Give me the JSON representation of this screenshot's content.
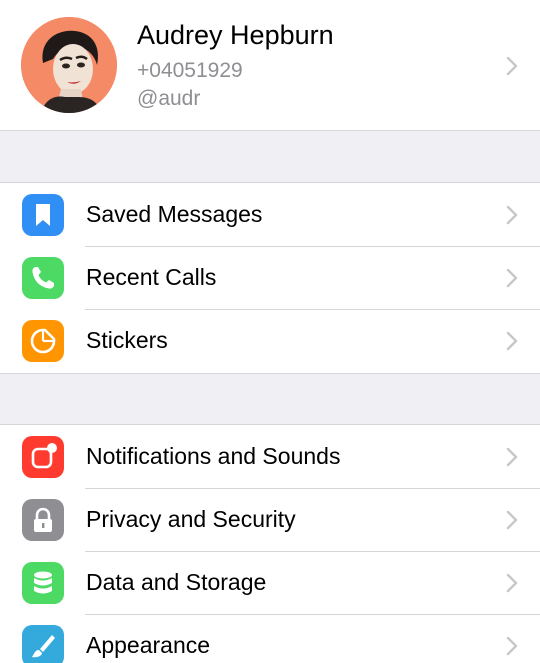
{
  "profile": {
    "name": "Audrey Hepburn",
    "phone": "+04051929",
    "username": "@audr"
  },
  "settings_group_1": [
    {
      "label": "Saved Messages",
      "icon": "bookmark-icon",
      "color": "#2f8ff5"
    },
    {
      "label": "Recent Calls",
      "icon": "phone-icon",
      "color": "#4cd964"
    },
    {
      "label": "Stickers",
      "icon": "sticker-icon",
      "color": "#ff9500"
    }
  ],
  "settings_group_2": [
    {
      "label": "Notifications and Sounds",
      "icon": "notification-badge-icon",
      "color": "#ff3b30"
    },
    {
      "label": "Privacy and Security",
      "icon": "lock-icon",
      "color": "#8e8e93"
    },
    {
      "label": "Data and Storage",
      "icon": "database-icon",
      "color": "#4cd964"
    },
    {
      "label": "Appearance",
      "icon": "brush-icon",
      "color": "#34aadc"
    }
  ],
  "colors": {
    "background": "#efeff4",
    "separator": "#d6d6da",
    "secondary_text": "#8e8e93",
    "chevron": "#c7c7cc"
  }
}
